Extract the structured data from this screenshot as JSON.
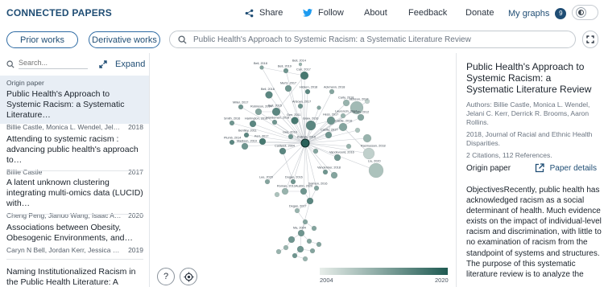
{
  "nav": {
    "logo": "CONNECTED PAPERS",
    "share": "Share",
    "follow": "Follow",
    "about": "About",
    "feedback": "Feedback",
    "donate": "Donate",
    "my_graphs": "My graphs",
    "my_graphs_count": "9"
  },
  "toolbar": {
    "prior_works": "Prior works",
    "derivative_works": "Derivative works",
    "search_value": "Public Health's Approach to Systemic Racism: a Systematic Literature Review"
  },
  "left_panel": {
    "search_placeholder": "Search...",
    "expand_label": "Expand",
    "origin_label": "Origin paper",
    "papers": [
      {
        "title": "Public Health's Approach to Systemic Racism: a Systematic Literature…",
        "authors": "Billie Castle, Monica L. Wendel, Jelani C. Kerr…",
        "year": "2018"
      },
      {
        "title": "Attending to systemic racism : advancing public health's approach to…",
        "authors": "Billie Castle",
        "year": "2017"
      },
      {
        "title": "A latent unknown clustering integrating multi-omics data (LUCID) with…",
        "authors": "Cheng Peng, Jianuo Wang, Isaac Asante…",
        "year": "2020"
      },
      {
        "title": "Associations between Obesity, Obesogenic Environments, and…",
        "authors": "Caryn N Bell, Jordan Kerr, Jessica L. Young",
        "year": "2019"
      },
      {
        "title": "Naming Institutionalized Racism in the Public Health Literature: A Systematic…",
        "authors": "",
        "year": ""
      }
    ]
  },
  "graph": {
    "colorbar_min": "2004",
    "colorbar_max": "2020",
    "node_labels": [
      "Bell, 2018",
      "Bell, 2019",
      "Bell, 2014",
      "Carr, 2017",
      "Mertz, 2017",
      "Hicken, 2018",
      "Bell, 2016",
      "Ackmann, 2018",
      "Carty, 2018",
      "Miller, 2017",
      "Robinson, 2014",
      "Bell, 2015",
      "Arisoya, 2017",
      "Jackson, 2017",
      "Smith, 2016",
      "Harrington, 2016",
      "Hardeman, 2018",
      "Gee, 2011",
      "Graw, 2016",
      "Hess, 2017",
      "Laurencin, 2017",
      "Smith, 2012",
      "Bentley, 2011",
      "Kerr, 2017",
      "Gee, 2019",
      "Kolinek, 2016",
      "Castle, 2017",
      "Castle, 2018",
      "Plumb, 2014",
      "Madison, 2019",
      "Caldwell, 2004",
      "Vandevoord, 2016",
      "Rasmussen, 2018",
      "Liu, 2020",
      "Vandermer, 2018",
      "Dogan, 2016",
      "Lee, 2020",
      "Roman, 2013",
      "Austin, 2020",
      "Salmon, 2016",
      "Degas, 2017",
      "Ma, 2004"
    ]
  },
  "right_panel": {
    "title": "Public Health's Approach to Systemic Racism: a Systematic Literature Review",
    "authors": "Authors: Billie Castle, Monica L. Wendel, Jelani C. Kerr, Derrick R. Brooms, Aaron Rollins.",
    "journal": "2018, Journal of Racial and Ethnic Health Disparities.",
    "citations": "2 Citations, 112 References.",
    "origin_label": "Origin paper",
    "details_label": "Paper details",
    "abstract": "ObjectivesRecently, public health has acknowledged racism as a social determinant of health. Much evidence exists on the impact of individual-level racism and discrimination, with little to no examination of racism from the standpoint of systems and structures. The purpose of this systematic literature review is to analyze the"
  },
  "colors": {
    "brand": "#1f4d74",
    "node_dark": "#1f5a52",
    "node_light": "#e8eeea",
    "selected_bg": "#e8eef5"
  }
}
